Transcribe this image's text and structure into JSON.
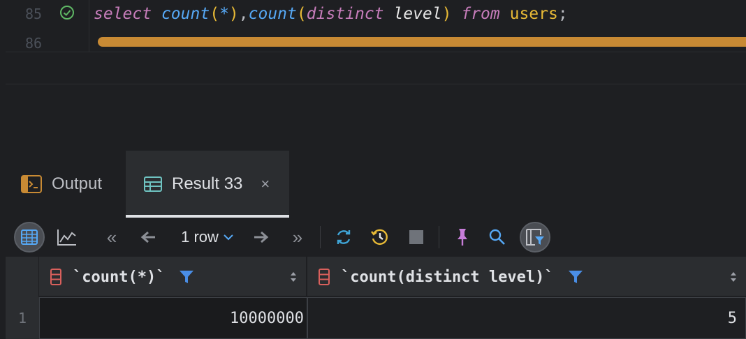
{
  "editor": {
    "lines": [
      {
        "number": "85"
      },
      {
        "number": "86"
      }
    ],
    "code": {
      "kw_select": "select",
      "fn_count1": "count",
      "paren_open1": "(",
      "star": "*",
      "paren_close1": ")",
      "comma": ",",
      "fn_count2": "count",
      "paren_open2": "(",
      "kw_distinct": "distinct",
      "ident_level": "level",
      "paren_close2": ")",
      "kw_from": "from",
      "table": "users",
      "semicolon": ";"
    }
  },
  "tool_window": {
    "tabs": [
      {
        "label": "Output",
        "icon": "output-console-icon",
        "active": false
      },
      {
        "label": "Result 33",
        "icon": "table-icon",
        "active": true,
        "close": "×"
      }
    ]
  },
  "toolbar": {
    "first_page": "«",
    "last_page": "»",
    "row_count": "1 row",
    "icons": [
      "table-view-icon",
      "chart-icon",
      "first-page-icon",
      "prev-page-icon",
      "next-page-icon",
      "last-page-icon",
      "refresh-icon",
      "history-icon",
      "stop-icon",
      "pin-icon",
      "search-icon",
      "filter-panel-icon"
    ]
  },
  "grid": {
    "columns": [
      {
        "title": "`count(*)`"
      },
      {
        "title": "`count(distinct level)`"
      }
    ],
    "rows": [
      {
        "num": "1",
        "cells": [
          "10000000",
          "5"
        ]
      }
    ]
  },
  "colors": {
    "background": "#1e1f22",
    "panel": "#2b2d30",
    "keyword": "#c77dbb",
    "function": "#56a8f5",
    "scrollbar": "#c88a34",
    "filter": "#4a8ee6",
    "check": "#5fb865"
  }
}
